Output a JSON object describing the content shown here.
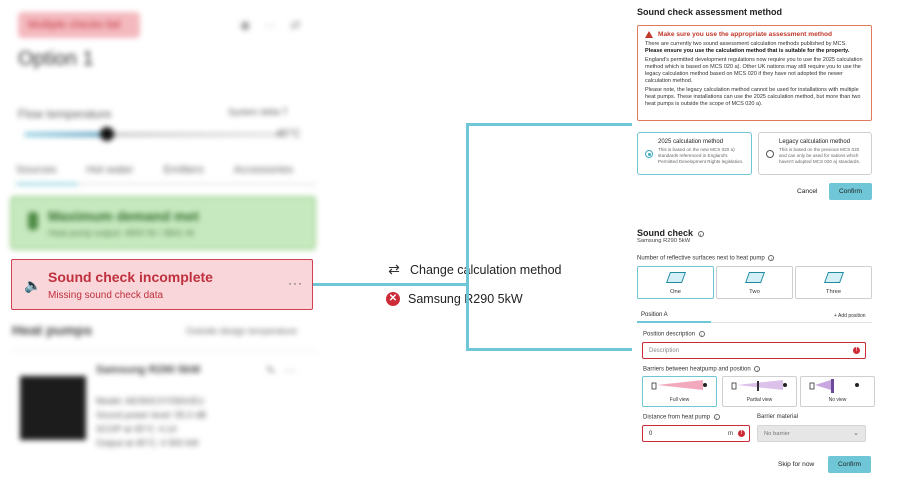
{
  "left": {
    "badge": "Multiple checks fail",
    "option_title": "Option 1",
    "flow_temperature_label": "Flow temperature",
    "flow_right_label": "System delta T",
    "slider_value": "45°C",
    "tabs": [
      "Sources",
      "Hot water",
      "Emitters",
      "Accessories"
    ],
    "demand_title": "Maximum demand met",
    "demand_sub": "Heat pump output: 4900 W / 3841 W",
    "sound_check": {
      "title": "Sound check incomplete",
      "subtitle": "Missing sound check data",
      "more": "···"
    },
    "heat_pumps_heading": "Heat pumps",
    "heat_pumps_right": "Outside design temperature",
    "heat_pump": {
      "name": "Samsung R290 5kW",
      "details": [
        "Model: AE050CXYDEK/EU",
        "Sound power level: 55.0 dB",
        "SCOP at 45°C: 4.14",
        "Output at 45°C: 4 900 kW"
      ]
    }
  },
  "middle": {
    "change_method": "Change calculation method",
    "heat_pump_fail": "Samsung R290 5kW"
  },
  "assessment": {
    "title": "Sound check assessment method",
    "warning": {
      "heading": "Make sure you use the appropriate assessment method",
      "p1_normal": "There are currently two sound assessment calculation methods published by MCS.",
      "p1_bold": "Please ensure you use the calculation method that is suitable for the property.",
      "p2": "England's permitted development regulations now require you to use the 2025 calculation method which is based on MCS 020 a). Other UK nations may still require you to use the legacy calculation method based on MCS 020 if they have not adopted the newer calculation method.",
      "p3": "Please note, the legacy calculation method cannot be used for installations with multiple heat pumps. These installations can use the 2025 calculation method, but more than two heat pumps is outside the scope of MCS 020 a)."
    },
    "methods": [
      {
        "title": "2025 calculation method",
        "desc": "This is based on the new MCS 020 a) standards referenced in England's Permitted Development Rights legislation."
      },
      {
        "title": "Legacy calculation method",
        "desc": "This is based on the previous MCS 020 and can only be used for nations which haven't adopted MCS 020 a) standards."
      }
    ],
    "cancel": "Cancel",
    "confirm": "Confirm"
  },
  "sound_check_form": {
    "title": "Sound check",
    "subtitle": "Samsung R290 5kW",
    "surfaces_label": "Number of reflective surfaces next to heat pump",
    "surfaces": [
      "One",
      "Two",
      "Three"
    ],
    "position_tab": "Position A",
    "add_position": "+ Add position",
    "position_desc_label": "Position description",
    "position_desc_placeholder": "Description",
    "barriers_label": "Barriers between heatpump and position",
    "views": [
      "Full view",
      "Partial view",
      "No view"
    ],
    "distance_label": "Distance from heat pump",
    "distance_value": "0",
    "distance_unit": "m",
    "material_label": "Barrier material",
    "material_value": "No barrier",
    "skip": "Skip for now",
    "confirm": "Confirm"
  },
  "colors": {
    "accent": "#6ec6d6",
    "error": "#cc2b37",
    "error_bg": "#f8d6da",
    "success_bg": "#c7e9bf"
  }
}
